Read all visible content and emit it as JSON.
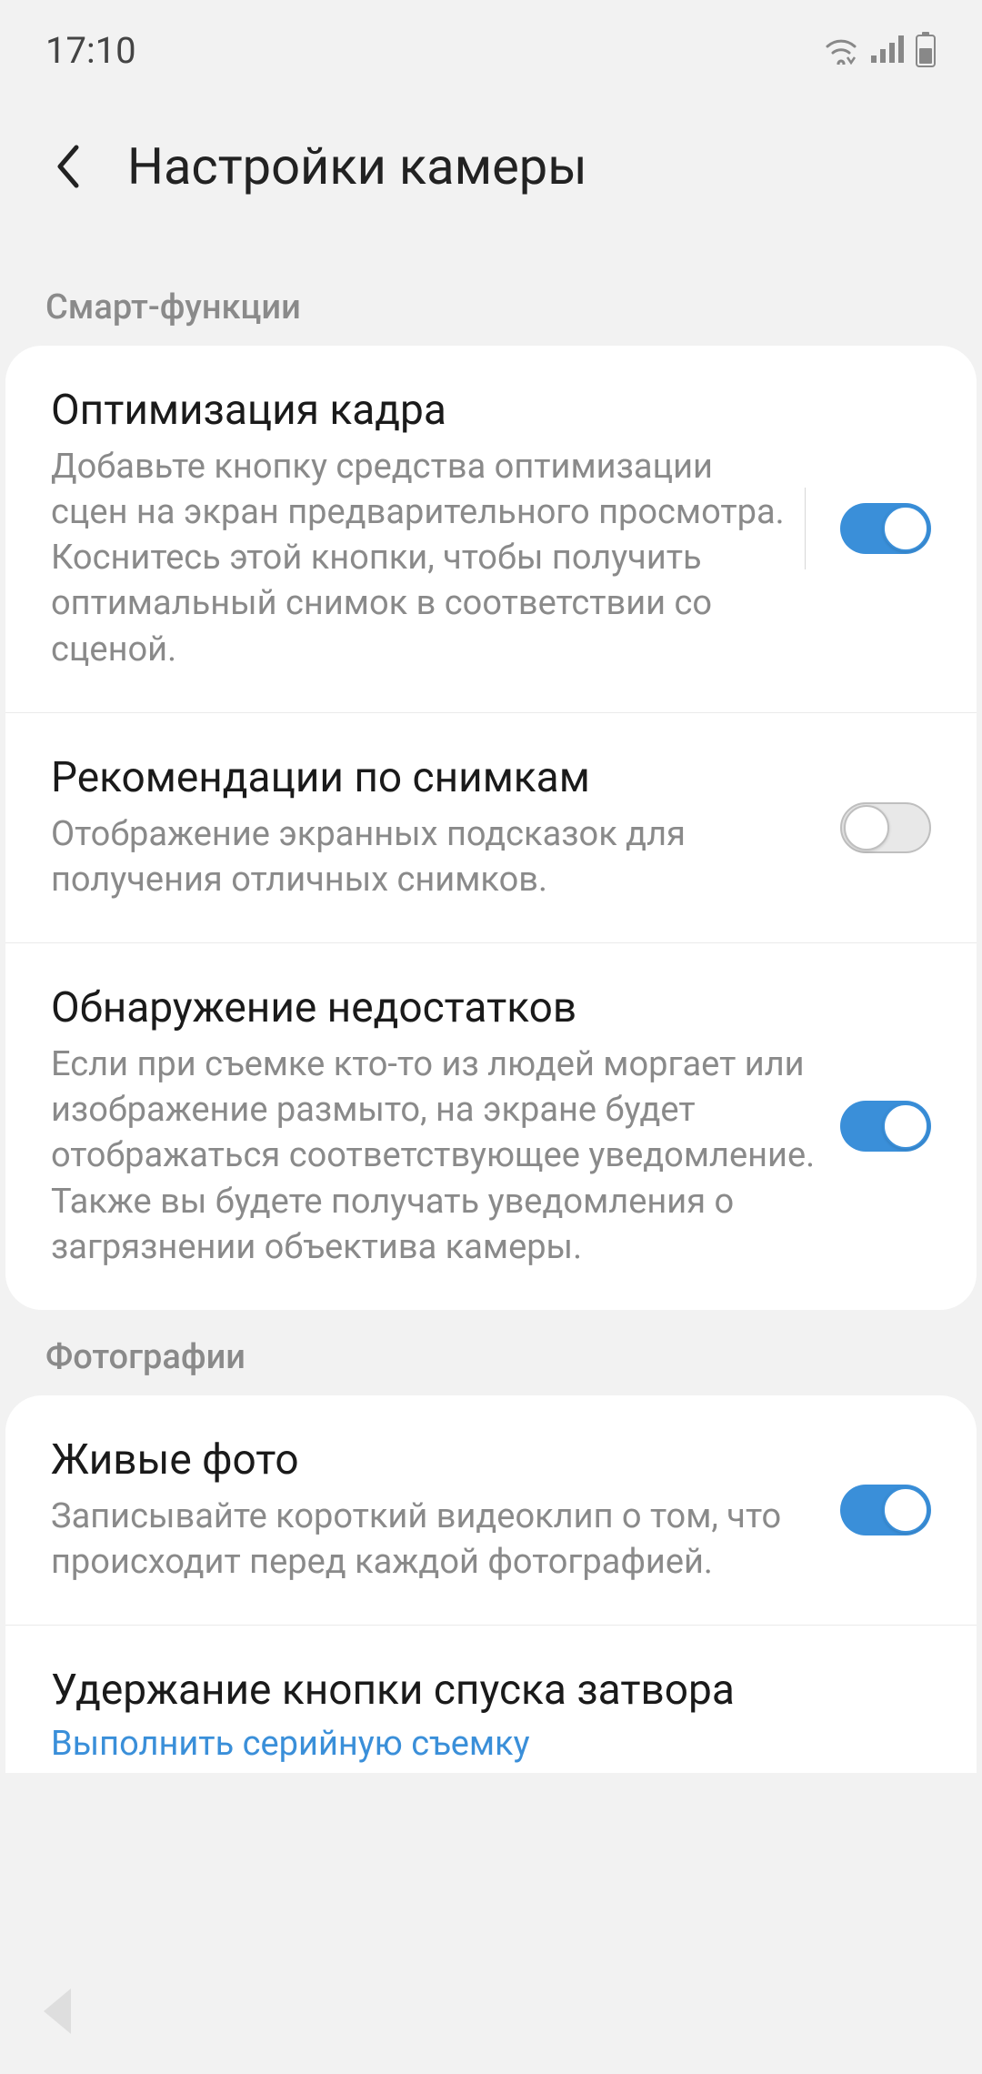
{
  "status": {
    "time": "17:10"
  },
  "header": {
    "title": "Настройки камеры"
  },
  "sections": [
    {
      "header": "Смарт-функции",
      "items": [
        {
          "title": "Оптимизация кадра",
          "desc": "Добавьте кнопку средства оптимизации сцен на экран предварительного просмотра. Коснитесь этой кнопки, чтобы получить оптимальный снимок в соответствии со сценой.",
          "toggle": true,
          "hasDivider": true
        },
        {
          "title": "Рекомендации по снимкам",
          "desc": "Отображение экранных подсказок для получения отличных снимков.",
          "toggle": false
        },
        {
          "title": "Обнаружение недостатков",
          "desc": "Если при съемке кто-то из людей моргает или изображение размыто, на экране будет отображаться соответствующее уведомление. Также вы будете получать уведомления о загрязнении объектива камеры.",
          "toggle": true
        }
      ]
    },
    {
      "header": "Фотографии",
      "items": [
        {
          "title": "Живые фото",
          "desc": "Записывайте короткий видеоклип о том, что происходит перед каждой фотографией.",
          "toggle": true
        },
        {
          "title": "Удержание кнопки спуска затвора",
          "value": "Выполнить серийную съемку"
        }
      ]
    }
  ]
}
